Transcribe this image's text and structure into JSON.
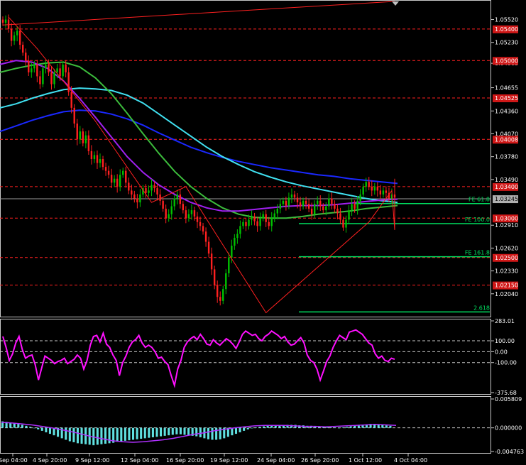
{
  "chart_data": {
    "type": "line",
    "colors": {
      "background": "#000000",
      "frame": "#c8c8c8",
      "bull": "#00c000",
      "bear": "#ff2020",
      "price_level": "#ff2020",
      "fib": "#00e060",
      "zigzag": "#ff2020",
      "ma_cyan": "#40e0f0",
      "ma_blue": "#1a28ff",
      "ma_green": "#3cbc3c",
      "ma_purple": "#a020f0",
      "cci": "#ff10ff",
      "macd_hist": "#60e0e0",
      "macd_signal": "#b030ff",
      "current_price_tag": "#b0b0b0"
    },
    "main_panel": {
      "ylim": [
        1.0175,
        1.0575
      ],
      "y_ticks": [
        1.0552,
        1.0523,
        1.04965,
        1.04655,
        1.0436,
        1.0407,
        1.0378,
        1.0349,
        1.0291,
        1.0262,
        1.0233,
        1.0204
      ],
      "y_tick_labels": [
        "1.05520",
        "1.05230",
        "1.04965",
        "1.04655",
        "1.04360",
        "1.04070",
        "1.03780",
        "1.03490",
        "1.02910",
        "1.02620",
        "1.02330",
        "1.02040"
      ],
      "current_price": 1.03245,
      "current_price_label": "1.03245",
      "level_lines": [
        {
          "value": 1.054,
          "label": "1.05400"
        },
        {
          "value": 1.05,
          "label": "1.05000"
        },
        {
          "value": 1.04525,
          "label": "1.04525"
        },
        {
          "value": 1.04,
          "label": "1.04008"
        },
        {
          "value": 1.034,
          "label": "1.03400"
        },
        {
          "value": 1.03,
          "label": "1.03000"
        },
        {
          "value": 1.025,
          "label": "1.02500"
        },
        {
          "value": 1.0215,
          "label": "1.02150"
        }
      ],
      "fib_levels": [
        {
          "value": 1.03185,
          "label": "FE 61.8"
        },
        {
          "value": 1.0293,
          "label": "FE 100.0"
        },
        {
          "value": 1.0251,
          "label": "FE 161.8"
        },
        {
          "value": 1.0181,
          "label": "2.618"
        }
      ],
      "zigzag": [
        [
          2,
          1.0555
        ],
        [
          12,
          1.0515
        ],
        [
          32,
          1.0425
        ],
        [
          52,
          1.032
        ],
        [
          64,
          1.034
        ],
        [
          92,
          1.018
        ],
        [
          128,
          1.0295
        ],
        [
          136,
          1.0335
        ],
        [
          146,
          1.0285
        ],
        [
          150,
          1.031
        ],
        [
          161,
          1.035
        ]
      ],
      "trendline": [
        [
          0,
          1.0545
        ],
        [
          170,
          1.0575
        ]
      ],
      "candles_close": [
        1.0548,
        1.0552,
        1.054,
        1.0525,
        1.0532,
        1.0538,
        1.052,
        1.051,
        1.05,
        1.0485,
        1.049,
        1.0495,
        1.048,
        1.047,
        1.049,
        1.0495,
        1.0485,
        1.047,
        1.0485,
        1.049,
        1.048,
        1.0495,
        1.0485,
        1.046,
        1.044,
        1.042,
        1.04,
        1.041,
        1.0395,
        1.0405,
        1.0385,
        1.0375,
        1.038,
        1.037,
        1.0375,
        1.0365,
        1.036,
        1.0355,
        1.0345,
        1.035,
        1.034,
        1.0355,
        1.036,
        1.0345,
        1.0335,
        1.033,
        1.0325,
        1.032,
        1.033,
        1.0338,
        1.0332,
        1.0335,
        1.0342,
        1.0338,
        1.033,
        1.0322,
        1.0312,
        1.03,
        1.0305,
        1.0315,
        1.0325,
        1.033,
        1.0318,
        1.031,
        1.03,
        1.0305,
        1.031,
        1.0302,
        1.0295,
        1.029,
        1.0283,
        1.027,
        1.0255,
        1.0235,
        1.0215,
        1.02,
        1.0195,
        1.021,
        1.023,
        1.025,
        1.0265,
        1.0275,
        1.028,
        1.029,
        1.0295,
        1.029,
        1.0298,
        1.0302,
        1.0296,
        1.029,
        1.03,
        1.0305,
        1.0295,
        1.029,
        1.03,
        1.0306,
        1.0312,
        1.0318,
        1.0322,
        1.0316,
        1.0326,
        1.033,
        1.0326,
        1.032,
        1.0315,
        1.0322,
        1.0318,
        1.0312,
        1.0305,
        1.0318,
        1.0322,
        1.0315,
        1.031,
        1.0315,
        1.0325,
        1.0318,
        1.0312,
        1.0306,
        1.0298,
        1.0288,
        1.0298,
        1.031,
        1.0318,
        1.0312,
        1.0322,
        1.033,
        1.034,
        1.0346,
        1.034,
        1.0335,
        1.034,
        1.0335,
        1.033,
        1.0335,
        1.0332,
        1.0325,
        1.033,
        1.0326
      ],
      "ma_cyan": [
        1.044,
        1.0445,
        1.0452,
        1.0458,
        1.0463,
        1.0465,
        1.0464,
        1.0462,
        1.0456,
        1.0446,
        1.0432,
        1.0418,
        1.0404,
        1.039,
        1.0378,
        1.0368,
        1.0359,
        1.0352,
        1.0346,
        1.0341,
        1.0337,
        1.0333,
        1.0329,
        1.0325,
        1.0322,
        1.032
      ],
      "ma_blue": [
        1.041,
        1.0417,
        1.0424,
        1.043,
        1.0435,
        1.0437,
        1.0436,
        1.0432,
        1.0426,
        1.0418,
        1.0408,
        1.0399,
        1.039,
        1.0383,
        1.0377,
        1.0372,
        1.0368,
        1.0364,
        1.0361,
        1.0358,
        1.0355,
        1.0353,
        1.035,
        1.0348,
        1.0346,
        1.0344
      ],
      "ma_green": [
        1.0485,
        1.049,
        1.0494,
        1.0497,
        1.0498,
        1.0492,
        1.0478,
        1.0458,
        1.0433,
        1.0407,
        1.0382,
        1.0359,
        1.034,
        1.0325,
        1.0313,
        1.0305,
        1.0301,
        1.03,
        1.03,
        1.0302,
        1.0305,
        1.0307,
        1.0309,
        1.0312,
        1.0314,
        1.0316
      ],
      "ma_purple": [
        1.0495,
        1.05,
        1.0498,
        1.049,
        1.0474,
        1.0452,
        1.0428,
        1.0403,
        1.0378,
        1.0358,
        1.0342,
        1.033,
        1.032,
        1.0313,
        1.0309,
        1.0309,
        1.0311,
        1.0313,
        1.0315,
        1.0316,
        1.0316,
        1.0317,
        1.0319,
        1.0321,
        1.0323,
        1.0324
      ]
    },
    "cci_panel": {
      "ylim": [
        -375.68,
        283.01
      ],
      "y_tick_labels": [
        "283.01",
        "100.00",
        "0.00",
        "-100.00",
        "-375.68"
      ],
      "levels": [
        100,
        0,
        -100
      ],
      "values": [
        140,
        40,
        -80,
        -20,
        80,
        140,
        20,
        -60,
        -40,
        -30,
        -120,
        -260,
        -150,
        -40,
        -60,
        -80,
        -110,
        -90,
        -80,
        -60,
        -110,
        -90,
        -70,
        -30,
        -60,
        -160,
        -80,
        60,
        140,
        150,
        90,
        170,
        70,
        40,
        -30,
        -80,
        -220,
        -100,
        -40,
        40,
        90,
        110,
        150,
        80,
        40,
        60,
        40,
        0,
        -60,
        -50,
        -90,
        -120,
        -220,
        -310,
        -160,
        -80,
        40,
        90,
        120,
        140,
        110,
        160,
        120,
        70,
        60,
        110,
        80,
        60,
        90,
        120,
        100,
        70,
        30,
        90,
        160,
        190,
        170,
        150,
        160,
        120,
        100,
        140,
        160,
        190,
        170,
        150,
        120,
        140,
        90,
        60,
        70,
        100,
        130,
        80,
        -30,
        -80,
        -100,
        -160,
        -260,
        -180,
        -90,
        -40,
        40,
        100,
        150,
        130,
        110,
        180,
        190,
        200,
        180,
        160,
        120,
        80,
        60,
        -20,
        -60,
        -40,
        -80,
        -90,
        -60,
        -70
      ],
      "show_series_name": false
    },
    "macd_panel": {
      "ylim": [
        -0.004763,
        0.005809
      ],
      "y_tick_labels": [
        "0.005809",
        "0.000000",
        "-0.004763"
      ],
      "hist": [
        0.0013,
        0.0012,
        0.0011,
        0.001,
        0.0008,
        0.0006,
        0.0004,
        0.0002,
        0.0,
        -0.0003,
        -0.0006,
        -0.0009,
        -0.0012,
        -0.0015,
        -0.0018,
        -0.0021,
        -0.0024,
        -0.0027,
        -0.0029,
        -0.0031,
        -0.0032,
        -0.0033,
        -0.0034,
        -0.0035,
        -0.0034,
        -0.0033,
        -0.0032,
        -0.0031,
        -0.003,
        -0.0028,
        -0.0027,
        -0.0026,
        -0.0025,
        -0.0024,
        -0.0023,
        -0.0022,
        -0.0021,
        -0.002,
        -0.0019,
        -0.0018,
        -0.0017,
        -0.0016,
        -0.0015,
        -0.0014,
        -0.0013,
        -0.0013,
        -0.0014,
        -0.0015,
        -0.0016,
        -0.0017,
        -0.0019,
        -0.0021,
        -0.0023,
        -0.0024,
        -0.0024,
        -0.0023,
        -0.0021,
        -0.0018,
        -0.0015,
        -0.0012,
        -0.0009,
        -0.0006,
        -0.0003,
        -0.0001,
        0.0001,
        0.0002,
        0.0003,
        0.0004,
        0.0004,
        0.0005,
        0.0005,
        0.0005,
        0.0006,
        0.0006,
        0.0006,
        0.0005,
        0.0005,
        0.0004,
        0.0004,
        0.0003,
        0.0003,
        0.0002,
        0.0002,
        0.0001,
        0.0001,
        0.0,
        0.0001,
        0.0002,
        0.0003,
        0.0004,
        0.0005,
        0.0006,
        0.0007,
        0.0008,
        0.0008,
        0.0007,
        0.0006,
        0.0005,
        0.0004
      ],
      "signal": [
        0.0011,
        0.001,
        0.0008,
        0.0006,
        0.0003,
        0.0,
        -0.0004,
        -0.0008,
        -0.0013,
        -0.0018,
        -0.0022,
        -0.0026,
        -0.0028,
        -0.0029,
        -0.0028,
        -0.0026,
        -0.0024,
        -0.0021,
        -0.0017,
        -0.0013,
        -0.001,
        -0.0006,
        -0.0003,
        0.0,
        0.0002,
        0.0004,
        0.0005,
        0.0005,
        0.0005,
        0.0004,
        0.0003,
        0.0003,
        0.0002,
        0.0003,
        0.0004,
        0.0005,
        0.0006,
        0.0007,
        0.0006,
        0.0005
      ]
    },
    "x_tick_labels": [
      "Sep 04:00",
      "4 Sep 20:00",
      "9 Sep 12:00",
      "12 Sep 04:00",
      "16 Sep 20:00",
      "19 Sep 12:00",
      "24 Sep 04:00",
      "26 Sep 20:00",
      "1 Oct 12:00",
      "4 Oct 04:00"
    ]
  }
}
